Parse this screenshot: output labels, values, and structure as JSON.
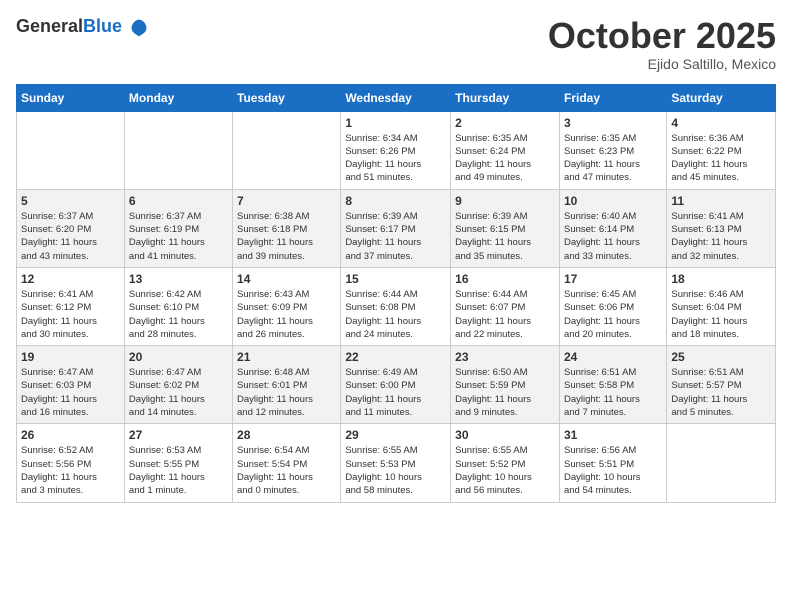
{
  "header": {
    "logo_general": "General",
    "logo_blue": "Blue",
    "month_title": "October 2025",
    "location": "Ejido Saltillo, Mexico"
  },
  "weekdays": [
    "Sunday",
    "Monday",
    "Tuesday",
    "Wednesday",
    "Thursday",
    "Friday",
    "Saturday"
  ],
  "weeks": [
    [
      {
        "day": "",
        "info": ""
      },
      {
        "day": "",
        "info": ""
      },
      {
        "day": "",
        "info": ""
      },
      {
        "day": "1",
        "info": "Sunrise: 6:34 AM\nSunset: 6:26 PM\nDaylight: 11 hours\nand 51 minutes."
      },
      {
        "day": "2",
        "info": "Sunrise: 6:35 AM\nSunset: 6:24 PM\nDaylight: 11 hours\nand 49 minutes."
      },
      {
        "day": "3",
        "info": "Sunrise: 6:35 AM\nSunset: 6:23 PM\nDaylight: 11 hours\nand 47 minutes."
      },
      {
        "day": "4",
        "info": "Sunrise: 6:36 AM\nSunset: 6:22 PM\nDaylight: 11 hours\nand 45 minutes."
      }
    ],
    [
      {
        "day": "5",
        "info": "Sunrise: 6:37 AM\nSunset: 6:20 PM\nDaylight: 11 hours\nand 43 minutes."
      },
      {
        "day": "6",
        "info": "Sunrise: 6:37 AM\nSunset: 6:19 PM\nDaylight: 11 hours\nand 41 minutes."
      },
      {
        "day": "7",
        "info": "Sunrise: 6:38 AM\nSunset: 6:18 PM\nDaylight: 11 hours\nand 39 minutes."
      },
      {
        "day": "8",
        "info": "Sunrise: 6:39 AM\nSunset: 6:17 PM\nDaylight: 11 hours\nand 37 minutes."
      },
      {
        "day": "9",
        "info": "Sunrise: 6:39 AM\nSunset: 6:15 PM\nDaylight: 11 hours\nand 35 minutes."
      },
      {
        "day": "10",
        "info": "Sunrise: 6:40 AM\nSunset: 6:14 PM\nDaylight: 11 hours\nand 33 minutes."
      },
      {
        "day": "11",
        "info": "Sunrise: 6:41 AM\nSunset: 6:13 PM\nDaylight: 11 hours\nand 32 minutes."
      }
    ],
    [
      {
        "day": "12",
        "info": "Sunrise: 6:41 AM\nSunset: 6:12 PM\nDaylight: 11 hours\nand 30 minutes."
      },
      {
        "day": "13",
        "info": "Sunrise: 6:42 AM\nSunset: 6:10 PM\nDaylight: 11 hours\nand 28 minutes."
      },
      {
        "day": "14",
        "info": "Sunrise: 6:43 AM\nSunset: 6:09 PM\nDaylight: 11 hours\nand 26 minutes."
      },
      {
        "day": "15",
        "info": "Sunrise: 6:44 AM\nSunset: 6:08 PM\nDaylight: 11 hours\nand 24 minutes."
      },
      {
        "day": "16",
        "info": "Sunrise: 6:44 AM\nSunset: 6:07 PM\nDaylight: 11 hours\nand 22 minutes."
      },
      {
        "day": "17",
        "info": "Sunrise: 6:45 AM\nSunset: 6:06 PM\nDaylight: 11 hours\nand 20 minutes."
      },
      {
        "day": "18",
        "info": "Sunrise: 6:46 AM\nSunset: 6:04 PM\nDaylight: 11 hours\nand 18 minutes."
      }
    ],
    [
      {
        "day": "19",
        "info": "Sunrise: 6:47 AM\nSunset: 6:03 PM\nDaylight: 11 hours\nand 16 minutes."
      },
      {
        "day": "20",
        "info": "Sunrise: 6:47 AM\nSunset: 6:02 PM\nDaylight: 11 hours\nand 14 minutes."
      },
      {
        "day": "21",
        "info": "Sunrise: 6:48 AM\nSunset: 6:01 PM\nDaylight: 11 hours\nand 12 minutes."
      },
      {
        "day": "22",
        "info": "Sunrise: 6:49 AM\nSunset: 6:00 PM\nDaylight: 11 hours\nand 11 minutes."
      },
      {
        "day": "23",
        "info": "Sunrise: 6:50 AM\nSunset: 5:59 PM\nDaylight: 11 hours\nand 9 minutes."
      },
      {
        "day": "24",
        "info": "Sunrise: 6:51 AM\nSunset: 5:58 PM\nDaylight: 11 hours\nand 7 minutes."
      },
      {
        "day": "25",
        "info": "Sunrise: 6:51 AM\nSunset: 5:57 PM\nDaylight: 11 hours\nand 5 minutes."
      }
    ],
    [
      {
        "day": "26",
        "info": "Sunrise: 6:52 AM\nSunset: 5:56 PM\nDaylight: 11 hours\nand 3 minutes."
      },
      {
        "day": "27",
        "info": "Sunrise: 6:53 AM\nSunset: 5:55 PM\nDaylight: 11 hours\nand 1 minute."
      },
      {
        "day": "28",
        "info": "Sunrise: 6:54 AM\nSunset: 5:54 PM\nDaylight: 11 hours\nand 0 minutes."
      },
      {
        "day": "29",
        "info": "Sunrise: 6:55 AM\nSunset: 5:53 PM\nDaylight: 10 hours\nand 58 minutes."
      },
      {
        "day": "30",
        "info": "Sunrise: 6:55 AM\nSunset: 5:52 PM\nDaylight: 10 hours\nand 56 minutes."
      },
      {
        "day": "31",
        "info": "Sunrise: 6:56 AM\nSunset: 5:51 PM\nDaylight: 10 hours\nand 54 minutes."
      },
      {
        "day": "",
        "info": ""
      }
    ]
  ]
}
